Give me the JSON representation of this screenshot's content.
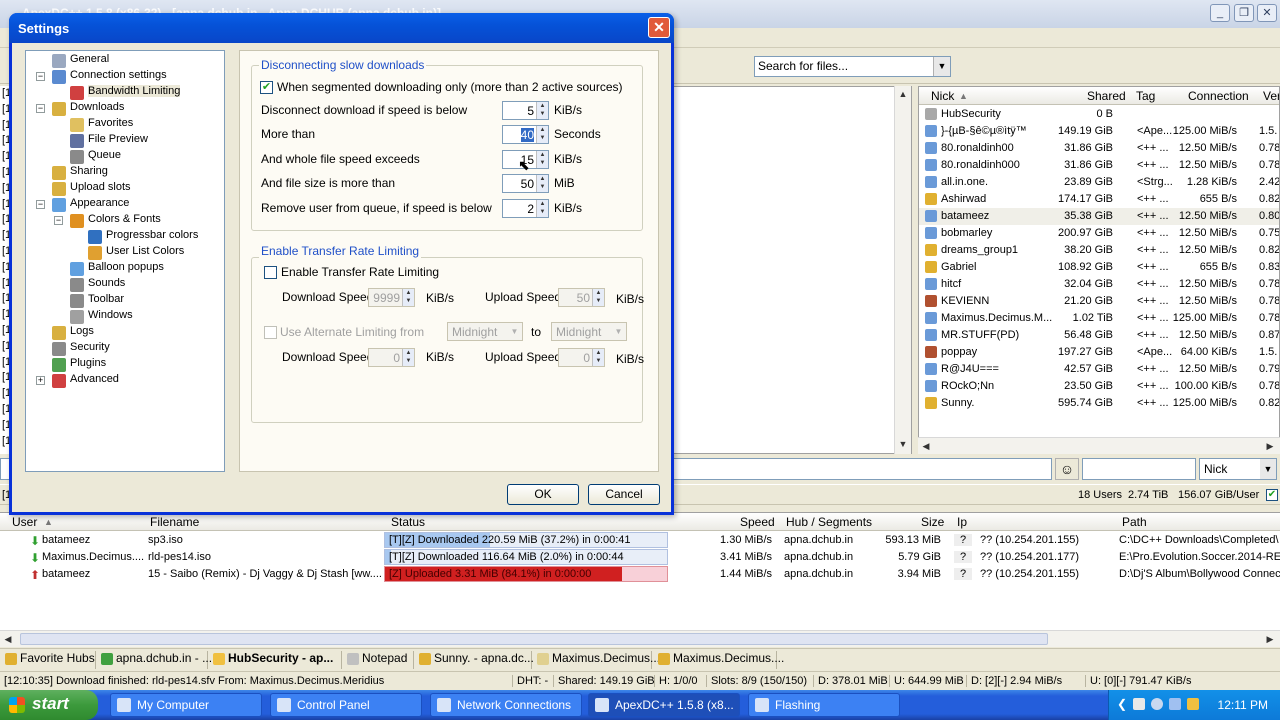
{
  "app": {
    "title": "ApexDC++ 1.5.8 (x86-32) - [apna.dchub.in - Apna DCHUB (apna.dchub.in)]"
  },
  "search": {
    "placeholder": "Search for files..."
  },
  "left_strip": [
    "[1",
    "[1",
    "[1",
    "[1",
    "[1",
    "[1",
    "[1",
    "[1",
    "[1",
    "[1",
    "[1",
    "[1",
    "[1",
    "[1",
    "[1",
    "[1",
    "[1",
    "[1",
    "[1",
    "[1",
    "[1",
    "[1",
    "[1"
  ],
  "users": {
    "headers": {
      "nick": "Nick",
      "shared": "Shared",
      "tag": "Tag",
      "connection": "Connection",
      "ver": "Ver"
    },
    "rows": [
      {
        "nick": "HubSecurity",
        "shared": "0 B",
        "tag": "",
        "conn": "",
        "ver": ""
      },
      {
        "nick": "}-{µB-§ê©µ®ìtÿ™",
        "shared": "149.19 GiB",
        "tag": "<Ape...",
        "conn": "125.00 MiB/s",
        "ver": "1.5."
      },
      {
        "nick": "80.ronaldinh00",
        "shared": "31.86 GiB",
        "tag": "<++ ...",
        "conn": "12.50 MiB/s",
        "ver": "0.78"
      },
      {
        "nick": "80.ronaldinh000",
        "shared": "31.86 GiB",
        "tag": "<++ ...",
        "conn": "12.50 MiB/s",
        "ver": "0.78"
      },
      {
        "nick": "all.in.one.",
        "shared": "23.89 GiB",
        "tag": "<Strg...",
        "conn": "1.28 KiB/s",
        "ver": "2.42"
      },
      {
        "nick": "Ashirwad",
        "shared": "174.17 GiB",
        "tag": "<++ ...",
        "conn": "655 B/s",
        "ver": "0.82"
      },
      {
        "nick": "batameez",
        "shared": "35.38 GiB",
        "tag": "<++ ...",
        "conn": "12.50 MiB/s",
        "ver": "0.80"
      },
      {
        "nick": "bobmarley",
        "shared": "200.97 GiB",
        "tag": "<++ ...",
        "conn": "12.50 MiB/s",
        "ver": "0.75"
      },
      {
        "nick": "dreams_group1",
        "shared": "38.20 GiB",
        "tag": "<++ ...",
        "conn": "12.50 MiB/s",
        "ver": "0.82"
      },
      {
        "nick": "Gabriel",
        "shared": "108.92 GiB",
        "tag": "<++ ...",
        "conn": "655 B/s",
        "ver": "0.83"
      },
      {
        "nick": "hitcf",
        "shared": "32.04 GiB",
        "tag": "<++ ...",
        "conn": "12.50 MiB/s",
        "ver": "0.78"
      },
      {
        "nick": "KEVIENN",
        "shared": "21.20 GiB",
        "tag": "<++ ...",
        "conn": "12.50 MiB/s",
        "ver": "0.78"
      },
      {
        "nick": "Maximus.Decimus.M...",
        "shared": "1.02 TiB",
        "tag": "<++ ...",
        "conn": "125.00 MiB/s",
        "ver": "0.78"
      },
      {
        "nick": "MR.STUFF(PD)",
        "shared": "56.48 GiB",
        "tag": "<++ ...",
        "conn": "12.50 MiB/s",
        "ver": "0.87"
      },
      {
        "nick": "poppay",
        "shared": "197.27 GiB",
        "tag": "<Ape...",
        "conn": "64.00 KiB/s",
        "ver": "1.5."
      },
      {
        "nick": "R@J4U===",
        "shared": "42.57 GiB",
        "tag": "<++ ...",
        "conn": "12.50 MiB/s",
        "ver": "0.79"
      },
      {
        "nick": "ROckO;Nn",
        "shared": "23.50 GiB",
        "tag": "<++ ...",
        "conn": "100.00 KiB/s",
        "ver": "0.78"
      },
      {
        "nick": "Sunny.",
        "shared": "595.74 GiB",
        "tag": "<++ ...",
        "conn": "125.00 MiB/s",
        "ver": "0.82"
      }
    ]
  },
  "nick_filter": "Nick",
  "hub_status": {
    "left": "[1",
    "users": "18 Users",
    "total": "2.74 TiB",
    "per_user": "156.07 GiB/User"
  },
  "transfers": {
    "headers": {
      "user": "User",
      "filename": "Filename",
      "status": "Status",
      "speed": "Speed",
      "hub": "Hub / Segments",
      "size": "Size",
      "ip": "Ip",
      "path": "Path"
    },
    "rows": [
      {
        "user": "batameez",
        "file": "sp3.iso",
        "status": "[T][Z] Downloaded 220.59 MiB (37.2%) in 0:00:41",
        "progress": 0.372,
        "speed": "1.30 MiB/s",
        "hub": "apna.dchub.in",
        "size": "593.13 MiB",
        "ip": "?? (10.254.201.155)",
        "path": "C:\\DC++ Downloads\\Completed\\",
        "dir": "down"
      },
      {
        "user": "Maximus.Decimus....",
        "file": "rld-pes14.iso",
        "status": "[T][Z] Downloaded 116.64 MiB (2.0%) in 0:00:44",
        "progress": 0.02,
        "speed": "3.41 MiB/s",
        "hub": "apna.dchub.in",
        "size": "5.79 GiB",
        "ip": "?? (10.254.201.177)",
        "path": "E:\\Pro.Evolution.Soccer.2014-RE",
        "dir": "down"
      },
      {
        "user": "batameez",
        "file": "15 - Saibo (Remix) - Dj Vaggy & Dj Stash [ww....",
        "status": "[Z] Uploaded 3.31 MiB (84.1%) in 0:00:00",
        "progress": 0.841,
        "speed": "1.44 MiB/s",
        "hub": "apna.dchub.in",
        "size": "3.94 MiB",
        "ip": "?? (10.254.201.155)",
        "path": "D:\\Dj'S Album\\Bollywood Connect",
        "dir": "up"
      }
    ]
  },
  "tabs": [
    "Favorite Hubs",
    "apna.dchub.in - ...",
    "HubSecurity - ap...",
    "Notepad",
    "Sunny. - apna.dc...",
    "Maximus.Decimus....",
    "Maximus.Decimus...."
  ],
  "statusbar": {
    "msg": "[12:10:35] Download finished: rld-pes14.sfv From: Maximus.Decimus.Meridius",
    "dht": "DHT: -",
    "shared": "Shared: 149.19 GiB",
    "hubs": "H: 1/0/0",
    "slots": "Slots: 8/9 (150/150)",
    "d": "D: 378.01 MiB",
    "u": "U: 644.99 MiB",
    "dspeed": "D: [2][-] 2.94 MiB/s",
    "uspeed": "U: [0][-] 791.47 KiB/s"
  },
  "taskbar": {
    "start": "start",
    "items": [
      "My Computer",
      "Control Panel",
      "Network Connections",
      "ApexDC++ 1.5.8 (x8...",
      "Flashing"
    ],
    "clock": "12:11 PM"
  },
  "settings": {
    "title": "Settings",
    "tree": [
      {
        "label": "General",
        "level": 1
      },
      {
        "label": "Connection settings",
        "level": 1
      },
      {
        "label": "Bandwidth Limiting",
        "level": 2
      },
      {
        "label": "Downloads",
        "level": 1
      },
      {
        "label": "Favorites",
        "level": 2
      },
      {
        "label": "File Preview",
        "level": 2
      },
      {
        "label": "Queue",
        "level": 2
      },
      {
        "label": "Sharing",
        "level": 1
      },
      {
        "label": "Upload slots",
        "level": 1
      },
      {
        "label": "Appearance",
        "level": 1
      },
      {
        "label": "Colors & Fonts",
        "level": 2
      },
      {
        "label": "Progressbar colors",
        "level": 3
      },
      {
        "label": "User List Colors",
        "level": 3
      },
      {
        "label": "Balloon popups",
        "level": 2
      },
      {
        "label": "Sounds",
        "level": 2
      },
      {
        "label": "Toolbar",
        "level": 2
      },
      {
        "label": "Windows",
        "level": 2
      },
      {
        "label": "Logs",
        "level": 1
      },
      {
        "label": "Security",
        "level": 1
      },
      {
        "label": "Plugins",
        "level": 1
      },
      {
        "label": "Advanced",
        "level": 1
      }
    ],
    "slow": {
      "group": "Disconnecting slow downloads",
      "segmented": "When segmented downloading only (more than 2 active sources)",
      "segmented_checked": true,
      "rows": [
        {
          "label": "Disconnect download if speed is below",
          "value": "5",
          "unit": "KiB/s"
        },
        {
          "label": "More than",
          "value": "40",
          "unit": "Seconds"
        },
        {
          "label": "And whole file speed exceeds",
          "value": "15",
          "unit": "KiB/s"
        },
        {
          "label": "And file size is more than",
          "value": "50",
          "unit": "MiB"
        },
        {
          "label": "Remove user from queue, if speed is below",
          "value": "2",
          "unit": "KiB/s"
        }
      ]
    },
    "limit": {
      "group": "Enable Transfer Rate Limiting",
      "enable": "Enable Transfer Rate Limiting",
      "download_speed": "Download Speed",
      "upload_speed": "Upload Speed",
      "dl1": "9999",
      "ul1": "50",
      "unit": "KiB/s",
      "alternate": "Use Alternate Limiting from",
      "from": "Midnight",
      "to_label": "to",
      "to": "Midnight",
      "dl2": "0",
      "ul2": "0"
    },
    "ok": "OK",
    "cancel": "Cancel"
  }
}
